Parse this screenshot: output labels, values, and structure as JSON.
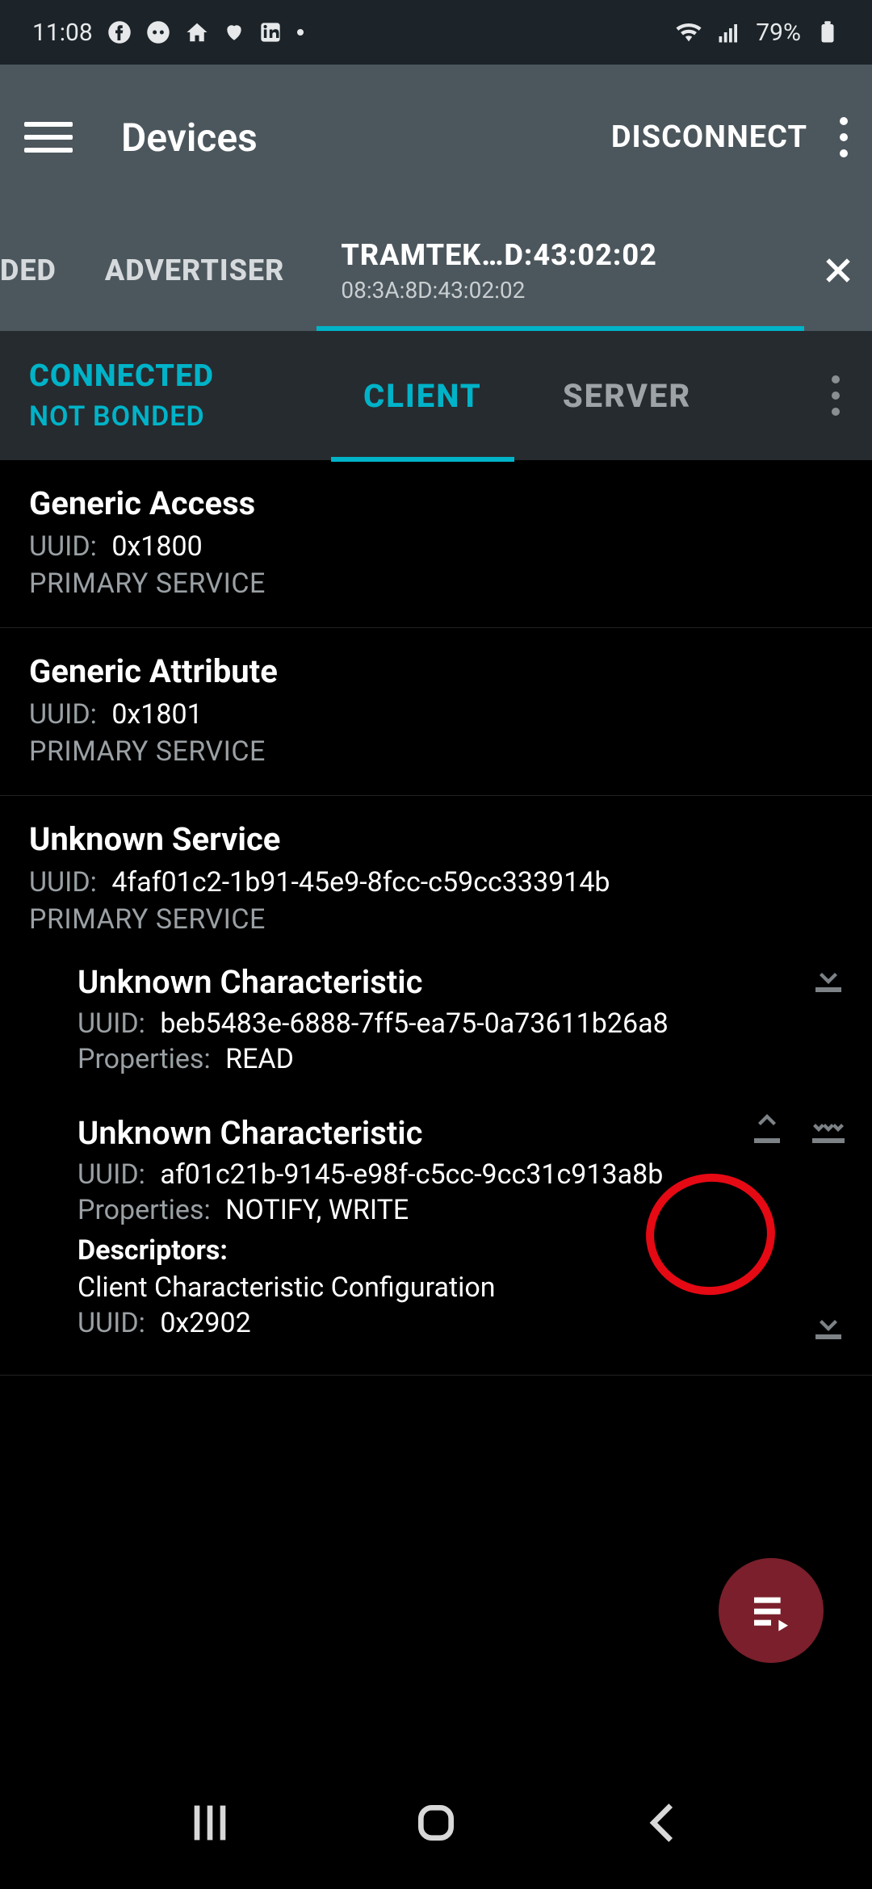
{
  "statusbar": {
    "time": "11:08",
    "battery": "79%"
  },
  "appbar": {
    "title": "Devices",
    "action": "DISCONNECT"
  },
  "tabs": {
    "partial": "DED",
    "advertiser": "ADVERTISER",
    "device_name": "TRAMTEK…D:43:02:02",
    "device_mac": "08:3A:8D:43:02:02"
  },
  "subheader": {
    "status1": "CONNECTED",
    "status2": "NOT BONDED",
    "client": "CLIENT",
    "server": "SERVER"
  },
  "labels": {
    "uuid": "UUID:",
    "properties": "Properties:",
    "primary_service": "PRIMARY SERVICE",
    "descriptors": "Descriptors:"
  },
  "services": [
    {
      "name": "Generic Access",
      "uuid": "0x1800"
    },
    {
      "name": "Generic Attribute",
      "uuid": "0x1801"
    },
    {
      "name": "Unknown Service",
      "uuid": "4faf01c2-1b91-45e9-8fcc-c59cc333914b",
      "characteristics": [
        {
          "name": "Unknown Characteristic",
          "uuid": "beb5483e-6888-7ff5-ea75-0a73611b26a8",
          "properties": "READ"
        },
        {
          "name": "Unknown Characteristic",
          "uuid": "af01c21b-9145-e98f-c5cc-9cc31c913a8b",
          "properties": "NOTIFY, WRITE",
          "descriptor_name": "Client Characteristic Configuration",
          "descriptor_uuid": "0x2902"
        }
      ]
    }
  ]
}
